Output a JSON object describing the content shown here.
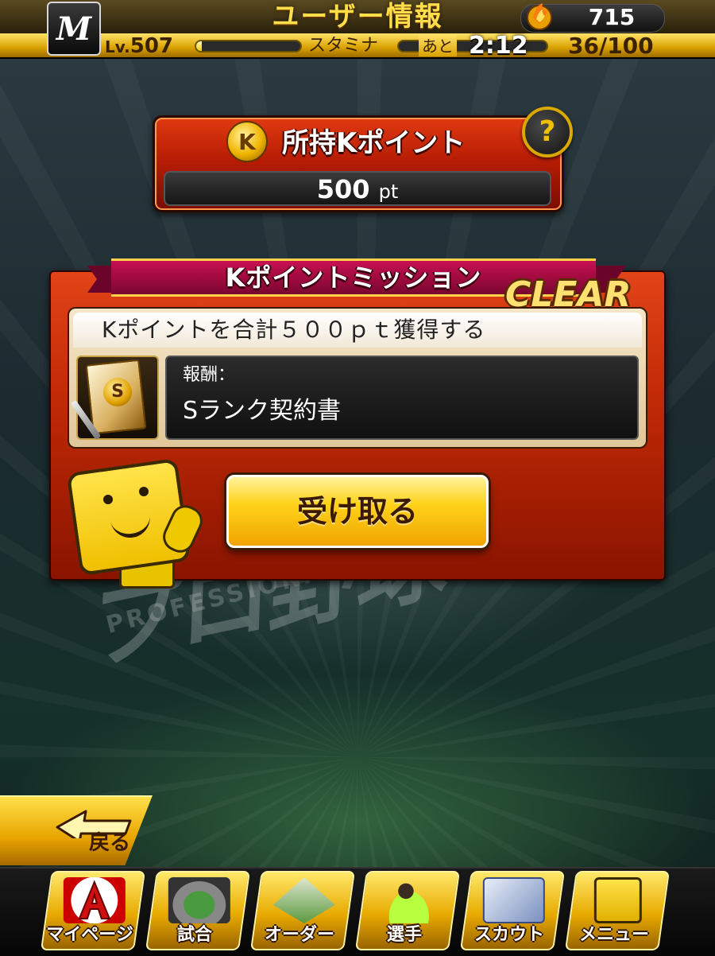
{
  "header": {
    "team_logo": "M",
    "title": "ユーザー情報",
    "coins": "715",
    "coin_icon": "fire-coin-icon",
    "level_prefix": "Lv.",
    "level": "507",
    "stamina_label": "スタミナ",
    "ato_label": "あと",
    "timer": "2:12",
    "stamina_count": "36/100",
    "stamina_fraction": 0.36,
    "exp_fraction": 0.05
  },
  "kpoint": {
    "coin_letter": "K",
    "title": "所持Kポイント",
    "value": "500",
    "unit": "pt",
    "help_label": "?"
  },
  "mission": {
    "ribbon_title": "Kポイントミッション",
    "clear_stamp": "CLEAR",
    "description": "Kポイントを合計５００ｐｔ獲得する",
    "reward_label": "報酬：",
    "reward_value": "Sランク契約書",
    "reward_icon_letter": "S",
    "receive_button": "受け取る"
  },
  "background": {
    "logo_text": "プロ野球",
    "logo_sub": "PROFESSIONAL BASEBALL"
  },
  "back_button": {
    "label": "戻る"
  },
  "nav": {
    "items": [
      {
        "label": "マイページ",
        "icon": "mypage-icon"
      },
      {
        "label": "試合",
        "icon": "stadium-icon"
      },
      {
        "label": "オーダー",
        "icon": "field-order-icon"
      },
      {
        "label": "選手",
        "icon": "player-icon"
      },
      {
        "label": "スカウト",
        "icon": "scout-icon"
      },
      {
        "label": "メニュー",
        "icon": "menu-mascot-icon"
      }
    ]
  },
  "colors": {
    "gold": "#ffd21a",
    "panel_red": "#c22a06",
    "ribbon_magenta": "#c81050"
  }
}
